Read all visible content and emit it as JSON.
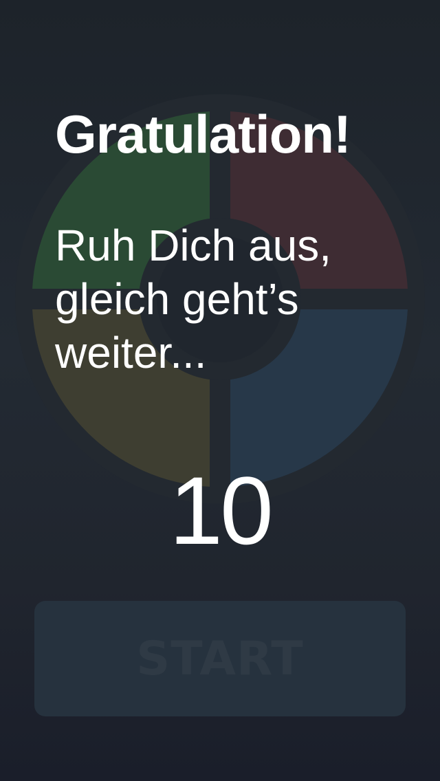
{
  "overlay": {
    "title": "Gratulation!",
    "message": "Ruh Dich aus,\ngleich geht’s\nweiter...",
    "countdown": "10"
  },
  "start_button": {
    "label": "START"
  },
  "board": {
    "quadrants": [
      {
        "name": "green",
        "color": "#2a4a34"
      },
      {
        "name": "red",
        "color": "#3e2c33"
      },
      {
        "name": "yellow",
        "color": "#3e3e31"
      },
      {
        "name": "blue",
        "color": "#273849"
      }
    ],
    "ring_color": "#252b33",
    "center_color": "#20262e"
  }
}
